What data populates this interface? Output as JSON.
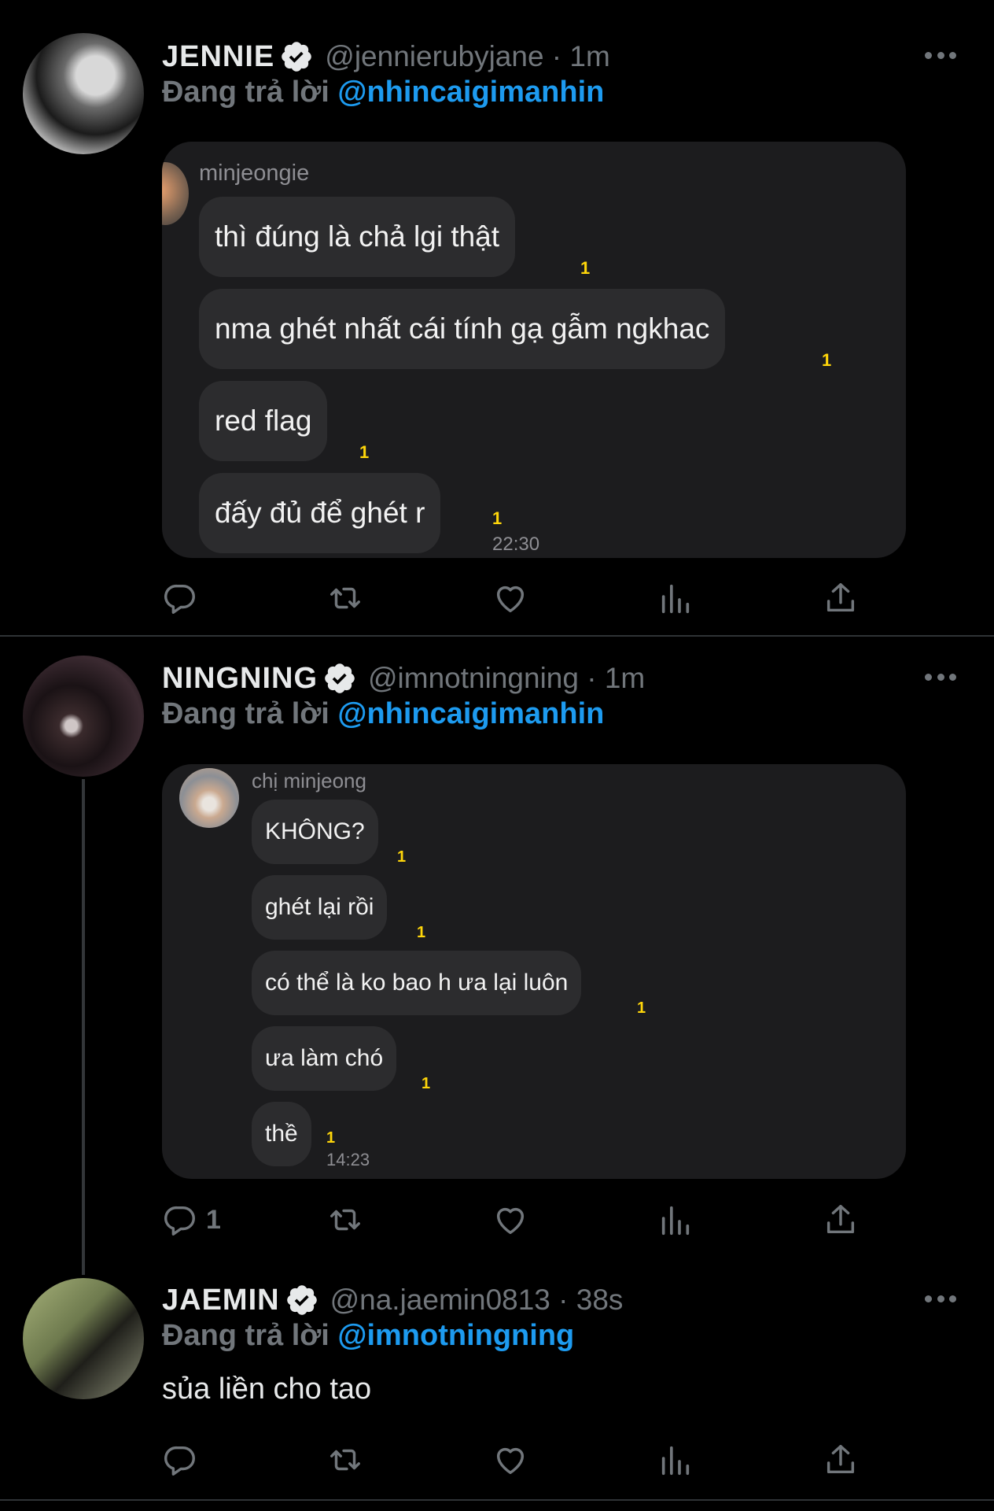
{
  "tweets": [
    {
      "display_name": "JENNIE",
      "handle_time": "@jennierubyjane · 1m",
      "reply_prefix": "Đang trả lời",
      "reply_to": "@nhincaigimanhin",
      "chat": {
        "sender": "minjeongie",
        "messages": [
          {
            "text": "thì đúng là chả lgi thật",
            "count": "1"
          },
          {
            "text": "nma ghét nhất cái tính gạ gẫm ngkhac",
            "count": "1"
          },
          {
            "text": "red flag",
            "count": "1"
          },
          {
            "text": "đấy đủ để ghét r",
            "count": "1"
          }
        ],
        "time": "22:30"
      },
      "reply_count": ""
    },
    {
      "display_name": "NINGNING",
      "handle_time": "@imnotningning · 1m",
      "reply_prefix": "Đang trả lời",
      "reply_to": "@nhincaigimanhin",
      "chat": {
        "sender": "chị minjeong",
        "messages": [
          {
            "text": "KHÔNG?",
            "count": "1"
          },
          {
            "text": "ghét lại rồi",
            "count": "1"
          },
          {
            "text": "có thể là ko bao h ưa lại luôn",
            "count": "1"
          },
          {
            "text": "ưa làm chó",
            "count": "1"
          },
          {
            "text": "thề",
            "count": "1"
          }
        ],
        "time": "14:23"
      },
      "reply_count": "1"
    },
    {
      "display_name": "JAEMIN",
      "handle_time": "@na.jaemin0813 · 38s",
      "reply_prefix": "Đang trả lời",
      "reply_to": "@imnotningning",
      "text": "sủa liền cho tao",
      "reply_count": ""
    }
  ],
  "icons": {
    "verified": "verified-badge-icon",
    "more": "more-options-icon",
    "reply": "reply-icon",
    "retweet": "retweet-icon",
    "like": "like-heart-icon",
    "views": "views-chart-icon",
    "share": "share-icon"
  },
  "colors": {
    "background": "#000000",
    "mention": "#1d9bf0",
    "muted": "#71767b",
    "bubble": "#2c2c2e",
    "card": "#1c1c1e",
    "read_count": "#ffd60a"
  }
}
